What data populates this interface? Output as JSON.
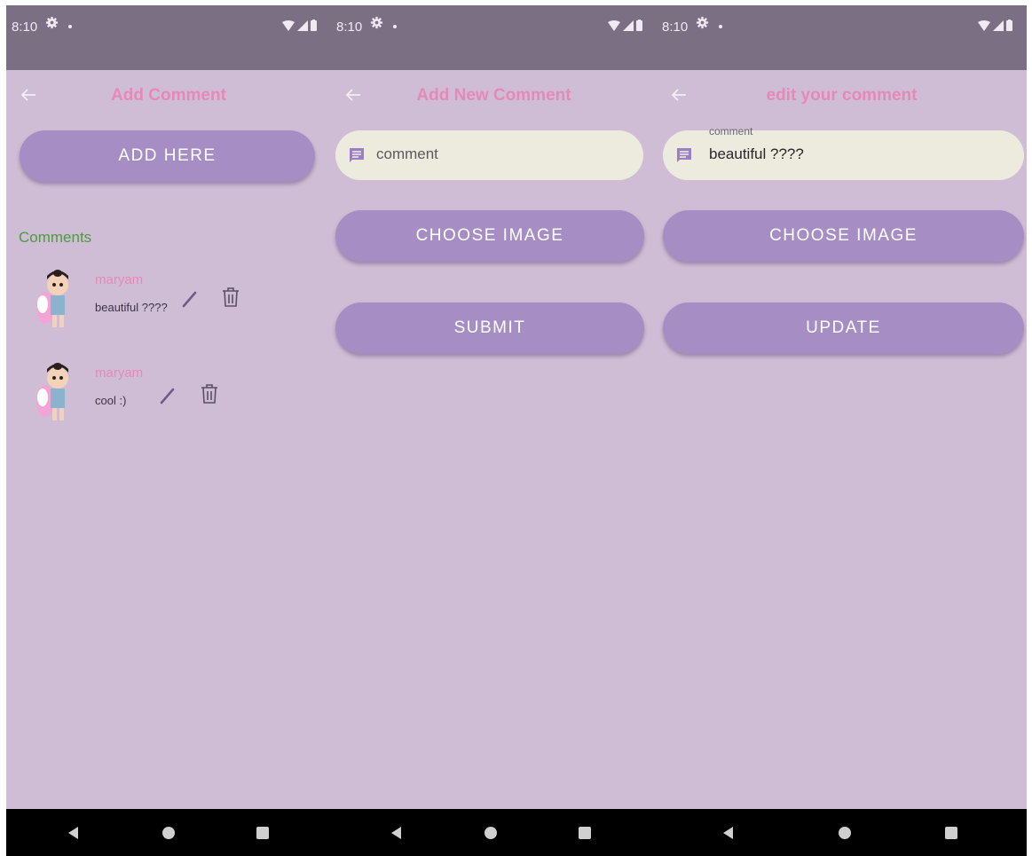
{
  "status_bar": {
    "time": "8:10"
  },
  "screens": [
    {
      "title": "Add Comment",
      "add_button": "ADD HERE",
      "section_label": "Comments",
      "comments": [
        {
          "author": "maryam",
          "text": "beautiful ????"
        },
        {
          "author": "maryam",
          "text": "cool :)"
        }
      ]
    },
    {
      "title": "Add New Comment",
      "comment_field": {
        "placeholder": "comment",
        "value": ""
      },
      "choose_image_button": "CHOOSE IMAGE",
      "submit_button": "SUBMIT"
    },
    {
      "title": "edit your comment",
      "comment_field": {
        "label": "comment",
        "value": "beautiful ????"
      },
      "choose_image_button": "CHOOSE IMAGE",
      "update_button": "UPDATE"
    }
  ],
  "icons": {
    "back": "arrow-left-icon",
    "comment": "comment-icon",
    "edit": "pencil-icon",
    "delete": "trash-icon",
    "settings": "gear-icon",
    "wifi": "wifi-icon",
    "signal": "signal-icon",
    "battery": "battery-icon"
  },
  "colors": {
    "background": "#cfbdd6",
    "status_bar": "#7b7083",
    "accent_title": "#e58ab6",
    "button": "#a68ec4",
    "input": "#ecebde",
    "section_label": "#4e9a3f"
  }
}
